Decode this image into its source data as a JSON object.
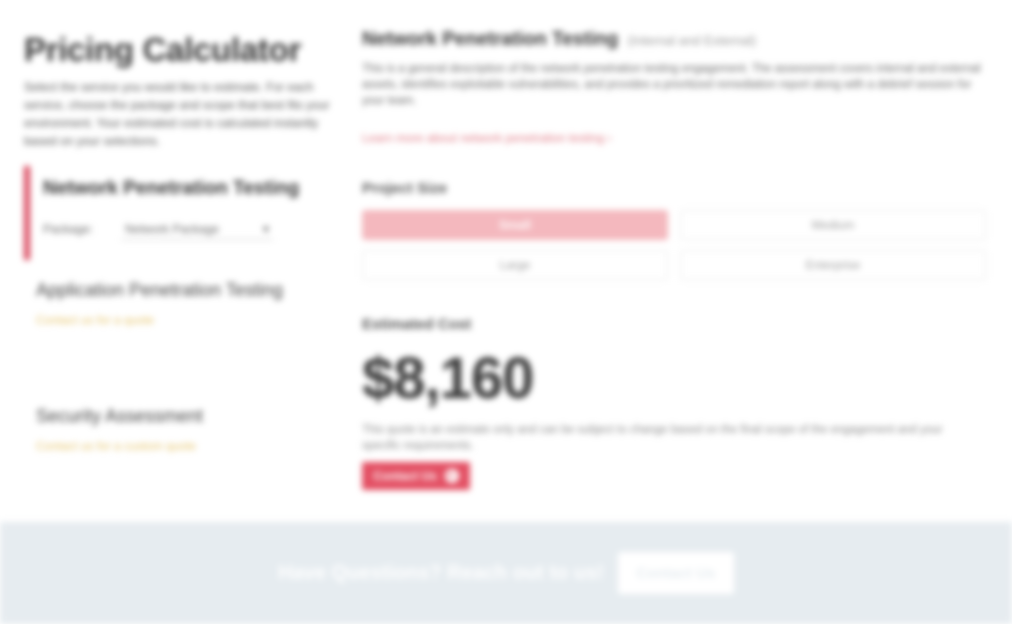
{
  "page_title": "Pricing Calculator",
  "intro": "Select the service you would like to estimate. For each service, choose the package and scope that best fits your environment. Your estimated cost is calculated instantly based on your selections.",
  "services": {
    "active": {
      "title": "Network Penetration Testing",
      "package_label": "Package:",
      "package_value": "Network Package"
    },
    "others": [
      {
        "name": "Application Penetration Testing",
        "link": "Contact us for a quote"
      },
      {
        "name": "Security Assessment",
        "link": "Contact us for a custom quote"
      }
    ]
  },
  "main": {
    "heading": "Network Penetration Testing",
    "heading_sub": "(Internal and External)",
    "description": "This is a general description of the network penetration testing engagement. The assessment covers internal and external assets, identifies exploitable vulnerabilities, and provides a prioritized remediation report along with a debrief session for your team.",
    "learn_more": "Learn more about network penetration testing",
    "project_size_label": "Project Size",
    "sizes": [
      {
        "label": "Small",
        "selected": true
      },
      {
        "label": "Medium",
        "selected": false
      },
      {
        "label": "Large",
        "selected": false
      },
      {
        "label": "Enterprise",
        "selected": false
      }
    ],
    "estimated_cost_label": "Estimated Cost",
    "price": "$8,160",
    "disclaimer": "This quote is an estimate only and can be subject to change based on the final scope of the engagement and your specific requirements.",
    "cta_label": "Contact Us"
  },
  "footer": {
    "question": "Have Questions? Reach out to us!",
    "button_label": "Contact Us"
  },
  "colors": {
    "accent": "#e34f63",
    "accent_light": "#f4b8be",
    "band": "#e6ecf0"
  }
}
